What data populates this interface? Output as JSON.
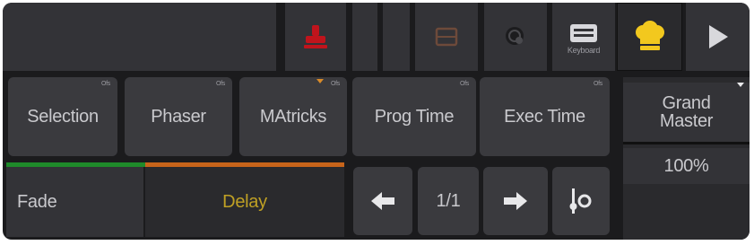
{
  "toolbar": {
    "keyboard_label": "Keyboard"
  },
  "row1": {
    "selection": {
      "label": "Selection",
      "tag": "Ofs"
    },
    "phaser": {
      "label": "Phaser",
      "tag": "Ofs"
    },
    "mattricks": {
      "label": "MAtricks",
      "tag": "Ofs"
    },
    "prog_time": {
      "label": "Prog Time",
      "tag": "Ofs"
    },
    "exec_time": {
      "label": "Exec Time",
      "tag": "Ofs"
    }
  },
  "row2": {
    "fade": {
      "label": "Fade"
    },
    "delay": {
      "label": "Delay"
    },
    "page": "1/1"
  },
  "grand_master": {
    "label": "Grand Master",
    "value": "100%"
  },
  "colors": {
    "panel": "#1b1b1d",
    "button": "#3a3a3e",
    "red_icon": "#c0141c",
    "chef_icon": "#f2c81e",
    "fade_bar": "#1f8a2a",
    "delay_bar": "#c7641a",
    "delay_text": "#bfa024"
  },
  "icons": [
    "stamp-icon",
    "clear-icon",
    "target-icon",
    "keyboard-icon",
    "chef-hat-icon",
    "play-icon",
    "arrow-left-icon",
    "arrow-right-icon",
    "settings-sliders-icon"
  ]
}
